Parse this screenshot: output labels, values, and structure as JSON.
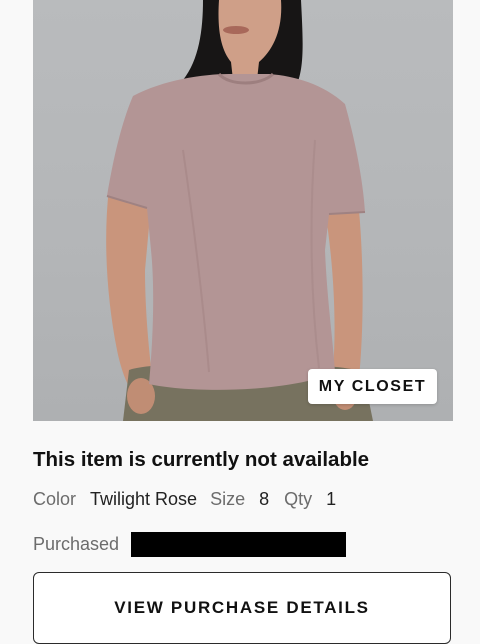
{
  "product": {
    "image_alt": "",
    "badge_label": "MY CLOSET"
  },
  "status": {
    "title": "This item is currently not available"
  },
  "attributes": {
    "color_label": "Color",
    "color_value": "Twilight Rose",
    "size_label": "Size",
    "size_value": "8",
    "qty_label": "Qty",
    "qty_value": "1"
  },
  "purchase": {
    "purchased_label": "Purchased"
  },
  "actions": {
    "view_details_label": "VIEW PURCHASE DETAILS"
  },
  "colors": {
    "background": "#f9f9f9",
    "photo_backdrop": "#b6b8ba",
    "shirt": "#b39595",
    "pants": "#77725f",
    "redaction": "#000000"
  }
}
